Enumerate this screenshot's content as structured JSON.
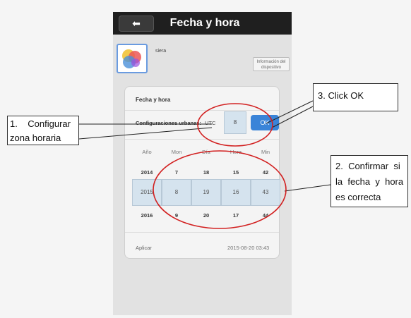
{
  "header": {
    "back_icon": "arrow-left-icon",
    "title": "Fecha y hora"
  },
  "device": {
    "icon": "device-app-icon",
    "name": "siera",
    "info_button": "Información del dispositivo"
  },
  "card": {
    "title": "Fecha y hora",
    "timezone_label": "Configuraciones urbanas:",
    "timezone_prefix": "UTC",
    "timezone_value": "8",
    "ok_button": "OK",
    "columns": [
      "Año",
      "Mon",
      "Día",
      "Hora",
      "Min"
    ],
    "row_prev": [
      "2014",
      "7",
      "18",
      "15",
      "42"
    ],
    "row_selected": [
      "2015",
      "8",
      "19",
      "16",
      "43"
    ],
    "row_next": [
      "2016",
      "9",
      "20",
      "17",
      "44"
    ],
    "apply_label": "Aplicar",
    "current_datetime": "2015-08-20 03:43"
  },
  "annotations": {
    "step1_line1": "1.    Configurar",
    "step1_line2": "zona horaria",
    "step2_line1": "2.  Confirmar  si",
    "step2_line2": "la  fecha  y  hora",
    "step2_line3": "es correcta",
    "step3": "3. Click OK",
    "colors": {
      "highlight_ellipse": "#d22020",
      "ok_blue": "#3a84d8",
      "titlebar": "#1f1f1f"
    }
  }
}
